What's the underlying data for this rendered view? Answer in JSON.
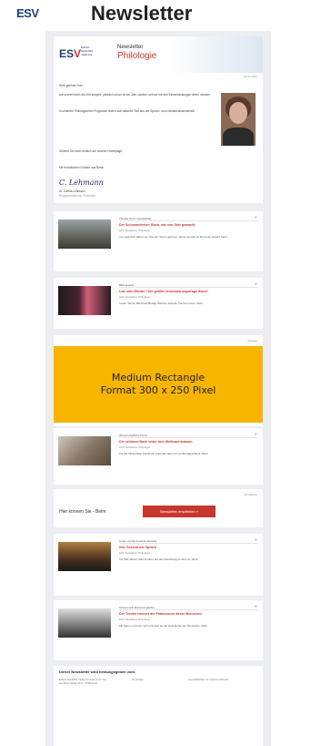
{
  "top": {
    "logo": "ESV",
    "title": "Newsletter"
  },
  "header": {
    "logo": "ES",
    "logo_v": "V",
    "logo_sub": "ERICH SCHMIDT VERLAG",
    "newsletter": "Newsletter",
    "subject": "Philologie"
  },
  "intro": {
    "date": "29.04.2021",
    "greeting": "Sehr geehrte Frau",
    "paragraph1": "wie schnell doch die Zeit vergeht: plötzlich schon ist ein Jahr vorüber, seit wir mit den Einschränkungen leben müssen.",
    "paragraph2": "In unserem Philologischen Programm finden sich aktuelle Titel aus der Sprach- und Literaturwissenschaft.",
    "paragraph3": "Stöbern Sie doch einfach auf unserer Homepage.",
    "closing": "Mit freundlichen Grüßen aus Berlin",
    "signature": "C. Lehmann",
    "name": "Dr. Carina Lehmann",
    "role": "Programmbereich Philologie"
  },
  "articles": [
    {
      "tag": "Theodor Storm Gesellschaft",
      "title": "Der Schimmelreiter: Buch, wie von Gott gemacht",
      "sub": "ESV Redaktion Philologie",
      "body": "Vor etwa 200 Jahren ist Theodor Storm geboren. Seine Novelle ist bis heute aktuell. Mehr"
    },
    {
      "tag": "Bibliographie",
      "title": "Lob oder Mörder? Die größte Verschwörungsfrage Bach?",
      "sub": "ESV Redaktion Philologie",
      "body": "Lieber Tanna, Bernhard Bettag: Bahnen aktuelle Themen lesen. Mehr"
    },
    {
      "tag": "Wissenschaftliche Praxis",
      "title": "Die schönen Buch unter dem Weihnachtsbaum",
      "sub": "ESV Redaktion Philologie",
      "body": "Für die bibliophilen Fachbuch Freunde Ideen für ein Buchgeschenk. Mehr"
    },
    {
      "tag": "Luther und die deutsche Sprache",
      "title": "Hier Gesicht der Sprach",
      "sub": "ESV Redaktion Philologie",
      "body": "Vor 500 Jahren stand Luther auf dem Reichstag zu Worms. Mehr"
    },
    {
      "tag": "Schwerpunkt Erinnerungskultur",
      "title": "Der Tronkli erinnert die Phänomene dieser Menschen",
      "sub": "ESV Redaktion Philologie",
      "body": "Mit Spuren erinnert sich eine Zeit an die Geschichte der Menschen. Mehr"
    }
  ],
  "ad": {
    "label": "Anzeige",
    "line1": "Medium Rectangle",
    "line2": "Format 300 x 250 Pixel"
  },
  "recommend": {
    "label": "Empfehlen",
    "question": "Hier können Sie - Beim",
    "button": "Newsletter empfehlen »"
  },
  "footer": {
    "title": "Dieser Newsletter wird herausgegeben vom:",
    "col1": "ERICH SCHMIDT VERLAG GmbH & Co. KG, Genthiner Straße 30 G, 10785 Berlin",
    "col2": "Ihr Kontakt",
    "col3": "Geschäftsführer: Dr. Joachim Schmidt"
  },
  "colors": {
    "accent": "#c8372d",
    "brand": "#1c3f7a",
    "ad": "#f7b500"
  }
}
